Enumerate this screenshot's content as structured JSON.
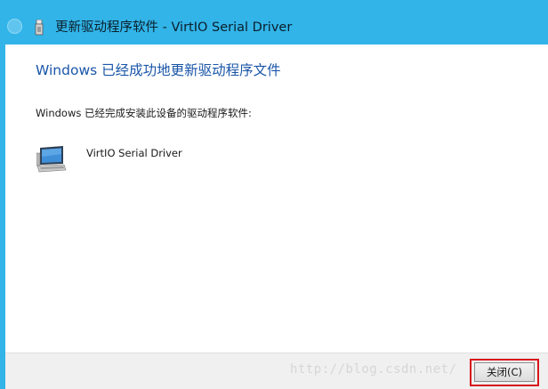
{
  "window": {
    "title": "更新驱动程序软件 - VirtIO Serial Driver",
    "frame_color": "#32b4e8"
  },
  "titlebar": {
    "back_icon": "back-arrow-icon",
    "app_icon": "usb-device-icon"
  },
  "content": {
    "heading": "Windows 已经成功地更新驱动程序文件",
    "heading_color": "#1a56a8",
    "message": "Windows 已经完成安装此设备的驱动程序软件:",
    "device": {
      "icon": "computer-monitor-icon",
      "name": "VirtIO Serial Driver"
    }
  },
  "footer": {
    "watermark": "http://blog.csdn.net/",
    "close_label": "关闭(C)",
    "highlight_color": "#d8141b"
  }
}
